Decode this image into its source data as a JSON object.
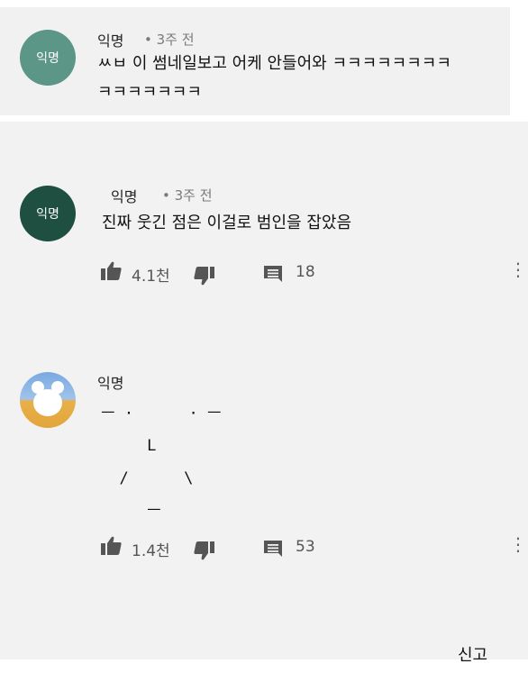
{
  "comment1": {
    "avatar_text": "익명",
    "user": "익명",
    "time": "• 3주 전",
    "line1": "ㅆㅂ 이 썸네일보고 어케 안들어와 ㅋㅋㅋㅋㅋㅋㅋㅋ",
    "line2": "ㅋㅋㅋㅋㅋㅋㅋ"
  },
  "comment2": {
    "avatar_text": "익명",
    "user": "익명",
    "time": "• 3주 전",
    "text": "진짜 웃긴 점은 이걸로 범인을 잡았음",
    "likes": "4.1천",
    "replies": "18"
  },
  "comment3": {
    "user": "익명",
    "ascii": [
      "ㅡ ·      · ㅡ",
      "     L",
      "  /      \\",
      "     ㅡ"
    ],
    "likes": "1.4천",
    "replies": "53"
  },
  "footer": {
    "report": "신고"
  },
  "colors": {
    "avatar1": "#5b9687",
    "avatar2": "#1e4f40",
    "avatar3_top": "#7aa9e0",
    "avatar3_bottom": "#e8b04a"
  }
}
